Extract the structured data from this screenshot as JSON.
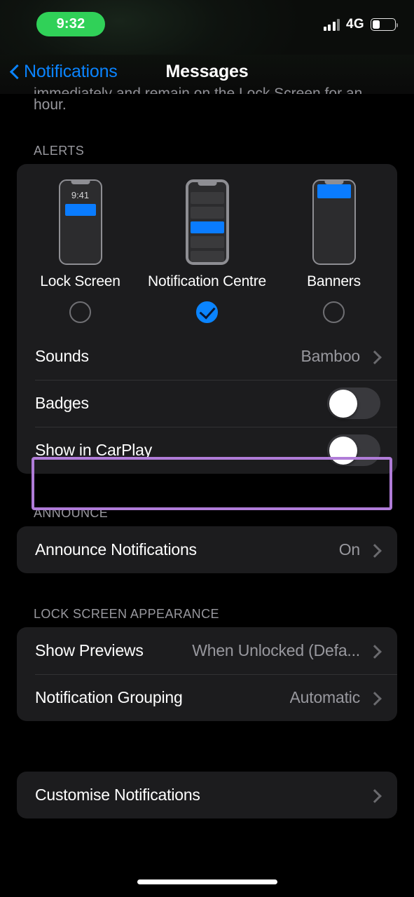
{
  "status_bar": {
    "time": "9:32",
    "time_pill_color": "#30d158",
    "network": "4G",
    "signal_bars_filled": 3,
    "signal_bars_total": 4,
    "battery_level_pct": 25
  },
  "nav": {
    "back_label": "Notifications",
    "title": "Messages",
    "accent_color": "#0a84ff"
  },
  "footnote": {
    "clipped_line": "immediately and remain on the Lock Screen for an",
    "text": "hour."
  },
  "alerts": {
    "header": "ALERTS",
    "options": [
      {
        "label": "Lock Screen",
        "selected": false,
        "preview": "lock-screen",
        "preview_time": "9:41"
      },
      {
        "label": "Notification Centre",
        "selected": true,
        "preview": "notification-centre"
      },
      {
        "label": "Banners",
        "selected": false,
        "preview": "banners"
      }
    ],
    "rows": [
      {
        "label": "Sounds",
        "value": "Bamboo",
        "type": "disclosure"
      },
      {
        "label": "Badges",
        "value": "",
        "type": "toggle",
        "on": false
      },
      {
        "label": "Show in CarPlay",
        "value": "",
        "type": "toggle",
        "on": false,
        "highlighted": true
      }
    ]
  },
  "announce": {
    "header": "ANNOUNCE",
    "rows": [
      {
        "label": "Announce Notifications",
        "value": "On",
        "type": "disclosure"
      }
    ]
  },
  "lock_screen_appearance": {
    "header": "LOCK SCREEN APPEARANCE",
    "rows": [
      {
        "label": "Show Previews",
        "value": "When Unlocked (Defa...",
        "type": "disclosure"
      },
      {
        "label": "Notification Grouping",
        "value": "Automatic",
        "type": "disclosure"
      }
    ]
  },
  "customise": {
    "rows": [
      {
        "label": "Customise Notifications",
        "value": "",
        "type": "disclosure"
      }
    ]
  },
  "annotation": {
    "color": "#b07cd8",
    "target": "Show in CarPlay"
  }
}
